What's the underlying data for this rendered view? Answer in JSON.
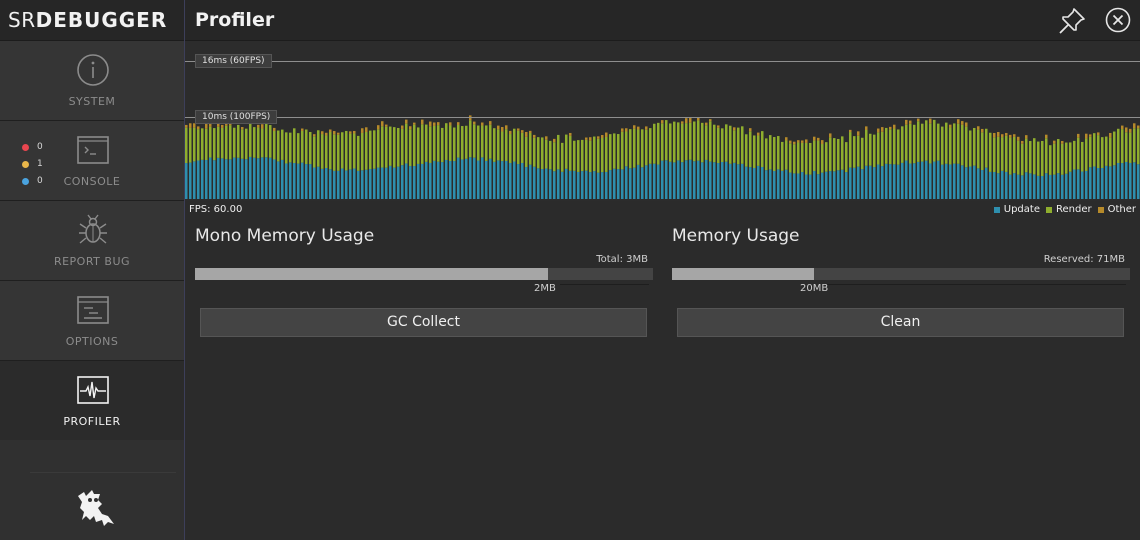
{
  "brand": {
    "prefix": "SR",
    "name": "DEBUGGER"
  },
  "header": {
    "title": "Profiler"
  },
  "sidebar": {
    "items": [
      {
        "label": "SYSTEM",
        "icon": "info-icon"
      },
      {
        "label": "CONSOLE",
        "icon": "console-icon"
      },
      {
        "label": "REPORT BUG",
        "icon": "bug-icon"
      },
      {
        "label": "OPTIONS",
        "icon": "options-icon"
      },
      {
        "label": "PROFILER",
        "icon": "pulse-icon",
        "active": true
      }
    ],
    "console_counts": [
      {
        "color": "#e9464f",
        "count": "0"
      },
      {
        "color": "#e9b64a",
        "count": "1"
      },
      {
        "color": "#4aa3df",
        "count": "0"
      }
    ]
  },
  "graph": {
    "guides": [
      {
        "label": "16ms (60FPS)",
        "ms": 16
      },
      {
        "label": "10ms (100FPS)",
        "ms": 10
      }
    ],
    "fps_label": "FPS: 60.00",
    "legend": [
      {
        "label": "Update",
        "color": "#2e8fae"
      },
      {
        "label": "Render",
        "color": "#8fae2e"
      },
      {
        "label": "Other",
        "color": "#b68a2a"
      }
    ]
  },
  "mono": {
    "title": "Mono Memory Usage",
    "total": "Total: 3MB",
    "used": "2MB",
    "used_fraction": 0.77,
    "button": "GC Collect"
  },
  "memory": {
    "title": "Memory Usage",
    "total": "Reserved: 71MB",
    "used": "20MB",
    "used_fraction": 0.31,
    "button": "Clean"
  }
}
